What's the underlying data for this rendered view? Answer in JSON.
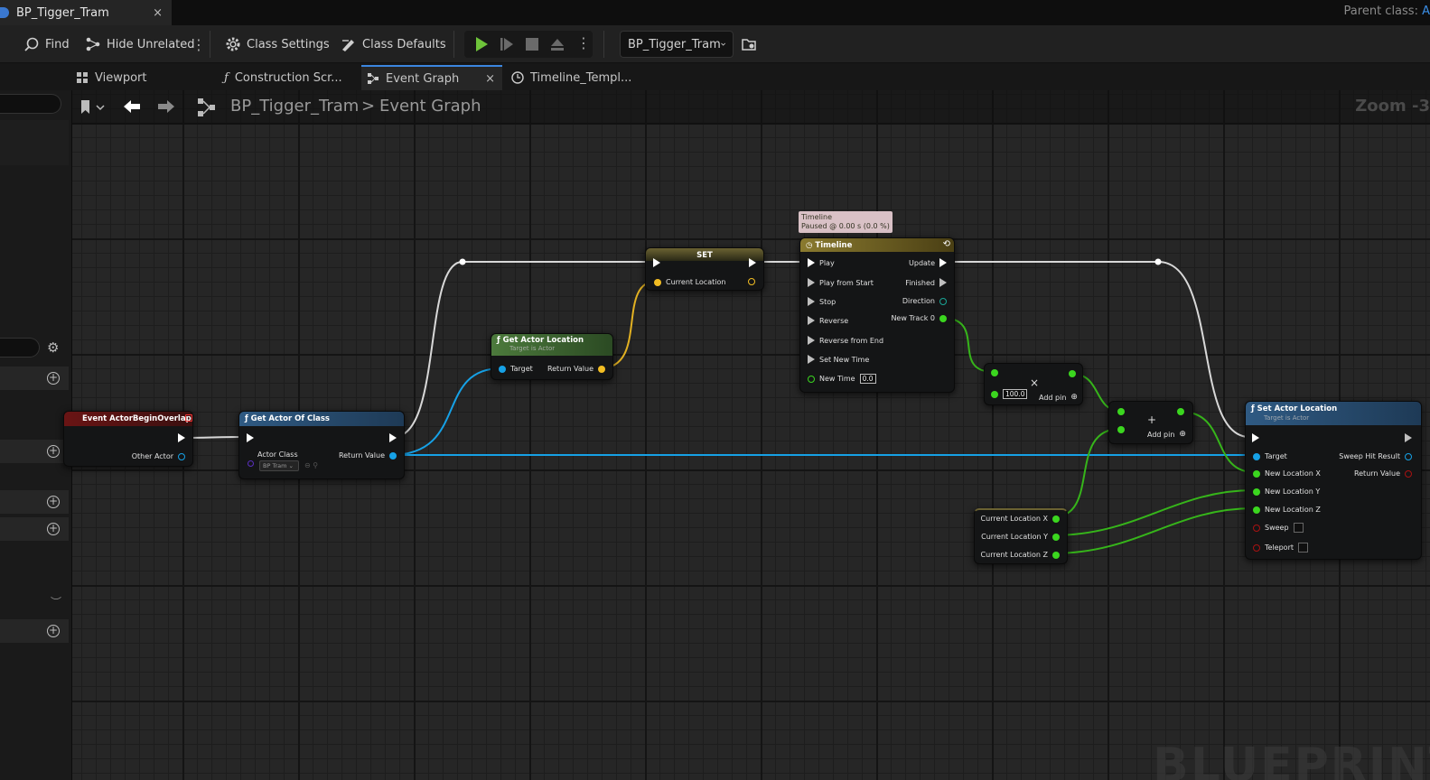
{
  "window": {
    "tab_title": "BP_Tigger_Tram",
    "close_glyph": "×",
    "parent_class_label": "Parent class:",
    "parent_class_value": "A"
  },
  "toolbar": {
    "find": "Find",
    "hide_unrelated": "Hide Unrelated",
    "class_settings": "Class Settings",
    "class_defaults": "Class Defaults",
    "debug_object": "BP_Tigger_Tram"
  },
  "tabs": [
    {
      "label": "Viewport",
      "icon": "viewport-icon"
    },
    {
      "label": "Construction Scr...",
      "icon": "function-icon"
    },
    {
      "label": "Event Graph",
      "icon": "graph-icon",
      "active": true
    },
    {
      "label": "Timeline_Templ...",
      "icon": "clock-icon"
    }
  ],
  "breadcrumb": {
    "root": "BP_Tigger_Tram",
    "separator": ">",
    "current": "Event Graph",
    "zoom": "Zoom -3"
  },
  "watermark": "BLUEPRINT",
  "nodes": {
    "overlap": {
      "title": "Event ActorBeginOverlap",
      "pin_other_actor": "Other Actor"
    },
    "get_actor_of_class": {
      "title": "Get Actor Of Class",
      "pin_actor_class": "Actor Class",
      "actor_class_value": "BP Tram",
      "pin_return": "Return Value"
    },
    "get_actor_location": {
      "title": "Get Actor Location",
      "subtitle": "Target is Actor",
      "pin_target": "Target",
      "pin_return": "Return Value"
    },
    "set": {
      "title": "SET",
      "pin_current_location": "Current Location"
    },
    "timeline": {
      "tooltip_line1": "Timeline",
      "tooltip_line2": "Paused @ 0.00 s (0.0 %)",
      "title": "Timeline",
      "inputs": [
        "Play",
        "Play from Start",
        "Stop",
        "Reverse",
        "Reverse from End",
        "Set New Time"
      ],
      "new_time_label": "New Time",
      "new_time_value": "0.0",
      "outputs": [
        "Update",
        "Finished"
      ],
      "direction": "Direction",
      "new_track": "New Track 0"
    },
    "multiply": {
      "symbol": "×",
      "value": "100.0",
      "add_pin": "Add pin"
    },
    "add": {
      "symbol": "+",
      "add_pin": "Add pin"
    },
    "current_location": {
      "pins": [
        "Current Location X",
        "Current Location Y",
        "Current Location Z"
      ]
    },
    "set_actor_location": {
      "title": "Set Actor Location",
      "subtitle": "Target is Actor",
      "pin_target": "Target",
      "pin_x": "New Location X",
      "pin_y": "New Location Y",
      "pin_z": "New Location Z",
      "pin_sweep": "Sweep",
      "pin_teleport": "Teleport",
      "out_sweep_hit": "Sweep Hit Result",
      "out_return": "Return Value"
    }
  },
  "colors": {
    "exec": "#ffffff",
    "object": "#00a8f4",
    "vector": "#f7c52a",
    "float": "#3bd61f",
    "bool": "#8c0a0a",
    "accent": "#3b86e0"
  }
}
